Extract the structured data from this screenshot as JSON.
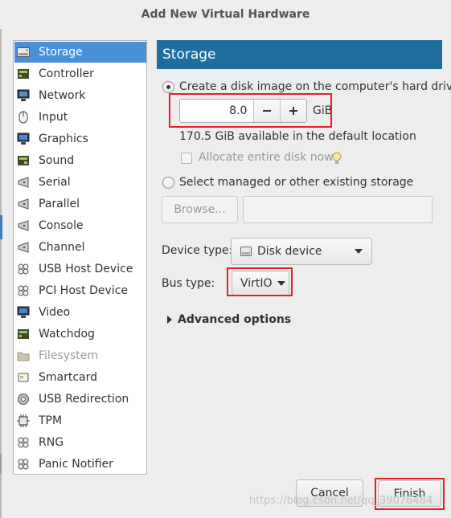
{
  "window": {
    "title": "Add New Virtual Hardware"
  },
  "hardware_list": [
    {
      "label": "Storage",
      "icon": "hard-disk-icon",
      "selected": true
    },
    {
      "label": "Controller",
      "icon": "controller-icon"
    },
    {
      "label": "Network",
      "icon": "network-icon"
    },
    {
      "label": "Input",
      "icon": "mouse-icon"
    },
    {
      "label": "Graphics",
      "icon": "monitor-icon"
    },
    {
      "label": "Sound",
      "icon": "sound-card-icon"
    },
    {
      "label": "Serial",
      "icon": "serial-port-icon"
    },
    {
      "label": "Parallel",
      "icon": "parallel-port-icon"
    },
    {
      "label": "Console",
      "icon": "console-icon"
    },
    {
      "label": "Channel",
      "icon": "channel-icon"
    },
    {
      "label": "USB Host Device",
      "icon": "usb-device-icon"
    },
    {
      "label": "PCI Host Device",
      "icon": "pci-device-icon"
    },
    {
      "label": "Video",
      "icon": "monitor-icon"
    },
    {
      "label": "Watchdog",
      "icon": "watchdog-icon"
    },
    {
      "label": "Filesystem",
      "icon": "folder-icon",
      "disabled": true
    },
    {
      "label": "Smartcard",
      "icon": "smartcard-icon"
    },
    {
      "label": "USB Redirection",
      "icon": "usb-redirection-icon"
    },
    {
      "label": "TPM",
      "icon": "chip-icon"
    },
    {
      "label": "RNG",
      "icon": "rng-icon"
    },
    {
      "label": "Panic Notifier",
      "icon": "panic-notifier-icon"
    }
  ],
  "storage": {
    "header": "Storage",
    "create_disk_label": "Create a disk image on the computer's hard drive",
    "disk_size_value": "8.0",
    "disk_size_unit": "GiB",
    "available_text": "170.5 GiB available in the default location",
    "allocate_label": "Allocate entire disk now",
    "select_existing_label": "Select managed or other existing storage",
    "browse_label": "Browse...",
    "existing_path_value": "",
    "device_type_label": "Device type:",
    "device_type_value": "Disk device",
    "bus_type_label": "Bus type:",
    "bus_type_value": "VirtIO",
    "advanced_label": "Advanced options"
  },
  "buttons": {
    "cancel": "Cancel",
    "finish": "Finish"
  },
  "watermark": "https://blog.csdn.net/qq_39076484",
  "colors": {
    "selection": "#4a90d9",
    "section_header": "#1e6d9e",
    "highlight_box": "#e2202a"
  }
}
